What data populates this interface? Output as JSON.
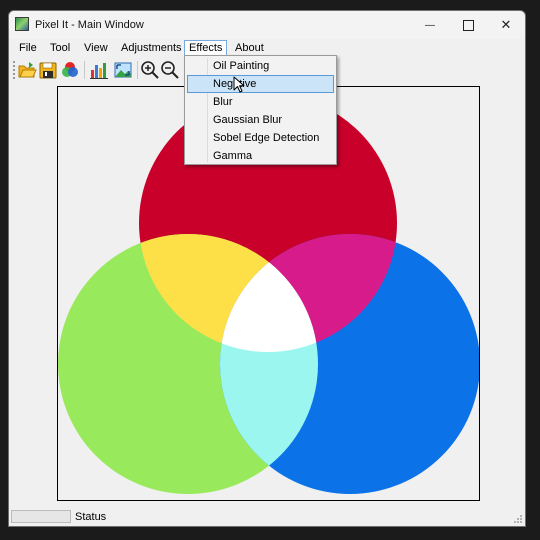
{
  "window": {
    "title": "Pixel It - Main Window"
  },
  "titlebar_buttons": {
    "minimize": "—",
    "close": "✕"
  },
  "menubar": {
    "items": [
      "File",
      "Tool",
      "View",
      "Adjustments",
      "Effects",
      "About"
    ],
    "active": "Effects"
  },
  "toolbar": {
    "buttons": [
      "open-folder-icon",
      "save-icon",
      "color-channels-icon",
      "histogram-icon",
      "fit-image-icon",
      "zoom-in-icon",
      "zoom-out-icon"
    ]
  },
  "effects_menu": {
    "items": [
      "Oil Painting",
      "Negative",
      "Blur",
      "Gaussian Blur",
      "Sobel Edge Detection",
      "Gamma"
    ],
    "hovered": "Negative"
  },
  "image": {
    "colors": {
      "red": "#c8002a",
      "green": "#99e95c",
      "blue": "#0b72e8",
      "yellow": "#fde048",
      "magenta": "#d81b8a",
      "cyan": "#9cf6f0",
      "white": "#ffffff"
    }
  },
  "statusbar": {
    "text": "Status"
  }
}
